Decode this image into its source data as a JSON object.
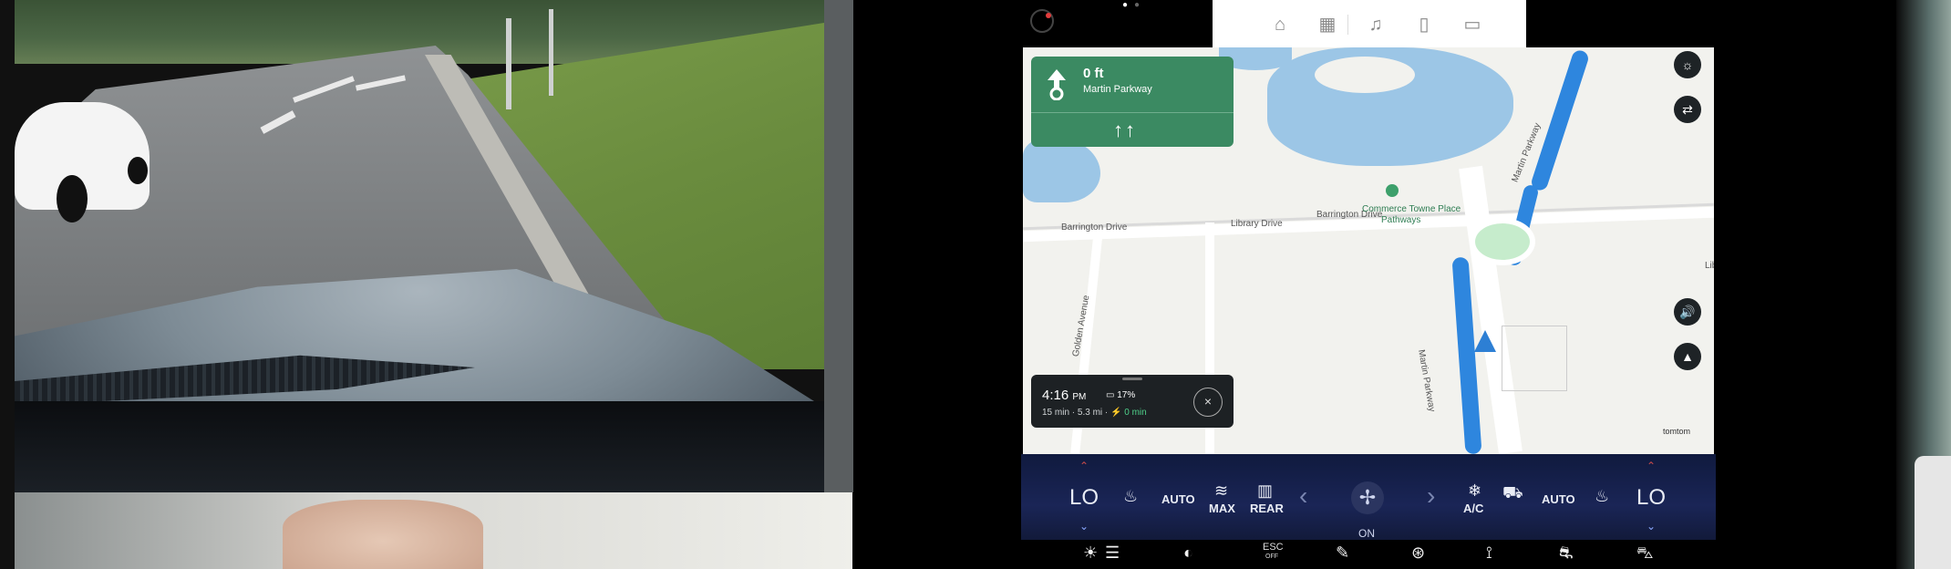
{
  "top_bar": {
    "page_dots": [
      "●",
      "●"
    ],
    "icons": [
      "home-icon",
      "apps-icon",
      "music-icon",
      "phone-icon",
      "camera-icon"
    ]
  },
  "nav": {
    "distance": "0 ft",
    "street": "Martin Parkway",
    "lane_guidance": "↑↑"
  },
  "eta": {
    "time": "4:16",
    "period": "PM",
    "battery": "17%",
    "duration": "15 min",
    "distance": "5.3 mi",
    "charge_time": "0 min",
    "close": "×"
  },
  "map": {
    "labels": {
      "barrington_w": "Barrington Drive",
      "library": "Library Drive",
      "barrington_e": "Barrington Drive",
      "commerce": "Commerce Towne Place",
      "pathways": "Pathways",
      "martin_n": "Martin Parkway",
      "martin_s": "Martin Parkway",
      "golden": "Golden Avenue",
      "edge": "Lib"
    },
    "attribution": "tomtom"
  },
  "climate": {
    "left_temp": "LO",
    "right_temp": "LO",
    "auto_left": "AUTO",
    "auto_right": "AUTO",
    "max": "MAX",
    "rear": "REAR",
    "ac": "A/C",
    "fan_status": "ON",
    "prev": "‹",
    "next": "›"
  },
  "bottom_bar": {
    "esc": "ESC",
    "esc_sub": "OFF"
  },
  "colors": {
    "nav_green": "#3b8a62",
    "route_blue": "#2e86de",
    "climate_bg": "#1a2556",
    "water": "#9cc6e6"
  }
}
